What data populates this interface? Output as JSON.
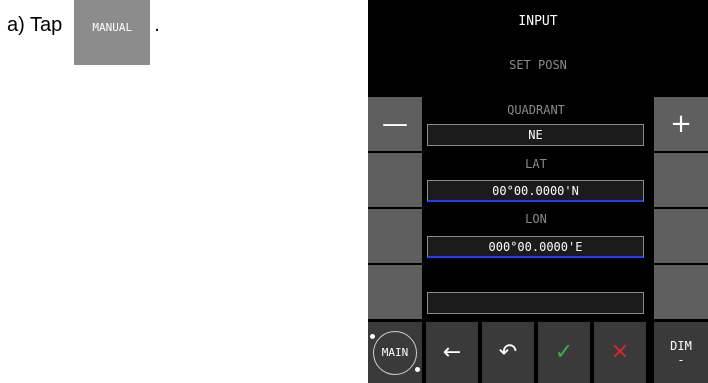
{
  "instruction": {
    "prefix": "a) Tap",
    "suffix": ".",
    "button_label": "MANUAL"
  },
  "screen": {
    "title": "INPUT",
    "subtitle": "SET POSN",
    "minus_symbol": "—",
    "plus_symbol": "+",
    "quadrant": {
      "label": "QUADRANT",
      "value": "NE"
    },
    "lat": {
      "label": "LAT",
      "value": "00°00.0000'N"
    },
    "lon": {
      "label": "LON",
      "value": "000°00.0000'E"
    },
    "empty_field": {
      "value": ""
    }
  },
  "bottom_bar": {
    "main_label": "MAIN",
    "back_symbol": "←",
    "undo_symbol": "↶",
    "confirm_symbol": "✓",
    "cancel_symbol": "✕",
    "dim_label": "DIM",
    "dim_value": "-"
  },
  "colors": {
    "confirm": "#3fae3f",
    "cancel": "#d02828",
    "field_underline": "#1f3cff"
  }
}
